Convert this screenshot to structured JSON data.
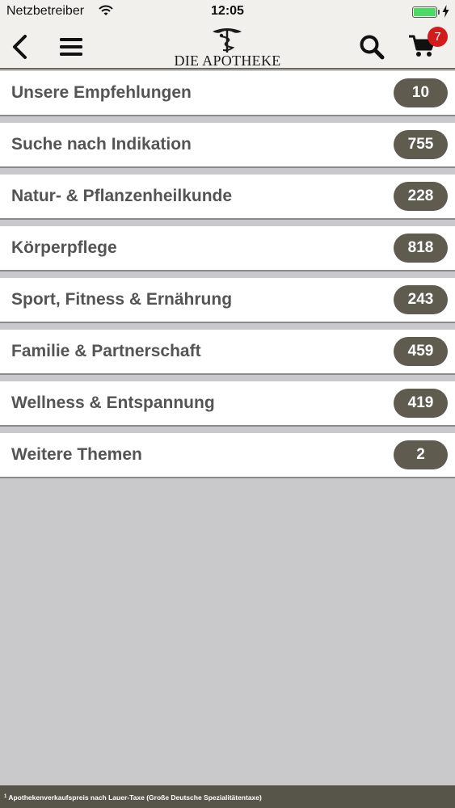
{
  "status_bar": {
    "carrier": "Netzbetreiber",
    "time": "12:05",
    "battery_level": 1.0,
    "charging": true,
    "icons": [
      "wifi-icon",
      "battery-icon",
      "charging-bolt-icon"
    ]
  },
  "nav": {
    "logo_text": "DIE APOTHEKE",
    "cart_count": "7",
    "icons": [
      "back-arrow-icon",
      "hamburger-menu-icon",
      "search-icon",
      "shopping-cart-icon",
      "caduceus-emblem"
    ]
  },
  "categories": [
    {
      "label": "Unsere Empfehlungen",
      "count": "10"
    },
    {
      "label": "Suche nach Indikation",
      "count": "755"
    },
    {
      "label": "Natur- & Pflanzenheilkunde",
      "count": "228"
    },
    {
      "label": "Körperpflege",
      "count": "818"
    },
    {
      "label": "Sport, Fitness & Ernährung",
      "count": "243"
    },
    {
      "label": "Familie & Partnerschaft",
      "count": "459"
    },
    {
      "label": "Wellness & Entspannung",
      "count": "419"
    },
    {
      "label": "Weitere Themen",
      "count": "2"
    }
  ],
  "footer": {
    "marker": "1",
    "text": "Apothekenverkaufspreis nach Lauer-Taxe (Große Deutsche Spezialitätentaxe)"
  },
  "colors": {
    "nav_background": "#f1f0ec",
    "badge": "#5f5b4f",
    "cart_badge": "#d31b1b",
    "page_background": "#c9c8cb",
    "footer": "#57544a",
    "battery": "#4cd964"
  }
}
